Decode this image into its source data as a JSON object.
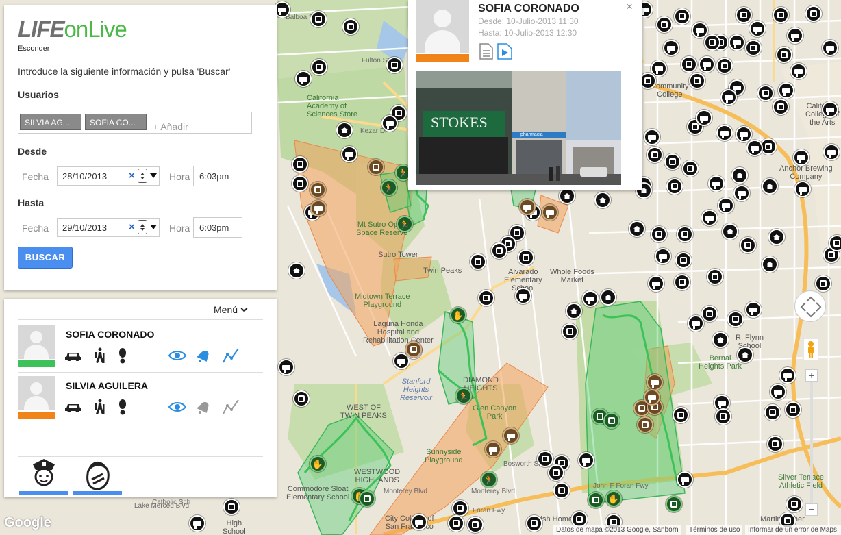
{
  "app": {
    "logo_life": "LIFE",
    "logo_onlive": "onLive",
    "hide_label": "Esconder"
  },
  "search": {
    "intro": "Introduce la siguiente información y pulsa 'Buscar'",
    "users_title": "Usuarios",
    "selected_users": [
      "SILVIA AG...",
      "SOFIA CO..."
    ],
    "add_placeholder": "+ Añadir",
    "from_title": "Desde",
    "to_title": "Hasta",
    "date_label": "Fecha",
    "time_label": "Hora",
    "from_date": "28/10/2013",
    "from_time": "6:03pm",
    "to_date": "29/10/2013",
    "to_time": "6:03pm",
    "search_button": "BUSCAR"
  },
  "users_panel": {
    "menu_label": "Menú",
    "users": [
      {
        "name": "SOFIA CORONADO",
        "color": "#3cc258",
        "active": true
      },
      {
        "name": "SILVIA AGUILERA",
        "color": "#f08419",
        "active": false
      }
    ],
    "bottom_icons": [
      "police-icon",
      "victim-icon"
    ]
  },
  "info_window": {
    "name": "SOFIA CORONADO",
    "from": "Desde: 10-Julio-2013 11:30",
    "to": "Hasta: 10-Julio-2013 12:30",
    "close": "×",
    "accent_color": "#f08419"
  },
  "map": {
    "labels": {
      "balboa": "Balboa St",
      "fulton": "Fulton St",
      "academy": "California\nAcademy of\nSciences Store",
      "kezar": "Kezar Dr",
      "sutro_res": "Mt Sutro Open\nSpace Reserve",
      "sutro_tower": "Sutro Tower",
      "twin_peaks": "Twin Peaks",
      "midtown": "Midtown Terrace\nPlayground",
      "laguna": "Laguna Honda\nHospital and\nRehabilitation Center",
      "stanford": "Stanford\nHeights\nReservoir",
      "glen": "Glen Canyon\nPark",
      "diamond": "DIAMOND\nHEIGHTS",
      "west_twin": "WEST OF\nTWIN PEAKS",
      "sunnyside": "Sunnyside\nPlayground",
      "westwood": "WESTWOOD\nHIGHLANDS",
      "commodore": "Commodore Sloat\nElementary School",
      "monterey": "Monterey Blvd",
      "ccsf": "City College of\nSan Francisco",
      "alvarado": "Alvarado\nElementary\nSchool",
      "wholefoods": "Whole Foods\nMarket",
      "bernal": "Bernal\nHeights Park",
      "flynn": "R. Flynn\nSchool",
      "anchor": "Anchor Brewing\nCompany",
      "silver": "Silver Terrace\nAthletic Field",
      "community": "Community\nCollege",
      "sfcollege": "California\nCollege of\nthe Arts",
      "bosworth": "Bosworth St",
      "foran": "John F Foran Fwy",
      "foran2": "Foran Fwy",
      "jewish": "Jewish Home",
      "highschool": "High\nSchool",
      "lakemerced": "Lake Merced Blvd",
      "catholic": "Catholic Sch",
      "luther": "Martin Luther"
    },
    "google_logo": "Google",
    "attribution": "Datos de mapa ©2013 Google, Sanborn",
    "terms": "Términos de uso",
    "report": "Informar de un error de Maps"
  }
}
